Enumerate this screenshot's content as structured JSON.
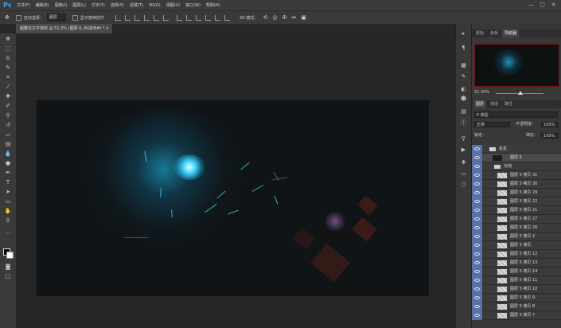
{
  "menubar": {
    "logo": "Ps",
    "items": [
      "文件(F)",
      "编辑(E)",
      "图像(I)",
      "图层(L)",
      "文字(Y)",
      "选择(S)",
      "滤镜(T)",
      "3D(D)",
      "视图(V)",
      "窗口(W)",
      "帮助(H)"
    ],
    "window_controls": [
      "—",
      "▢",
      "✕"
    ]
  },
  "options": {
    "auto_select_label": "自动选择：",
    "auto_select_value": "图层",
    "transform_label": "显示变换控件",
    "mode_3d_label": "3D 模式："
  },
  "document": {
    "tab_title": "超酷花文字特效 @ 51.3% (图层 6, RGB/8#) *",
    "close": "×"
  },
  "navigator": {
    "tabs": [
      "颜色",
      "色板",
      "导航器"
    ],
    "zoom": "51.34%"
  },
  "layers_panel": {
    "tabs": [
      "图层",
      "通道",
      "路径"
    ],
    "filter": "P 类型",
    "blend_mode": "正常",
    "opacity_label": "不透明度：",
    "opacity_value": "100%",
    "lock_label": "锁定：",
    "fill_label": "填充：",
    "fill_value": "100%",
    "rows": [
      {
        "name": "星星",
        "kind": "group"
      },
      {
        "name": "图层 6",
        "kind": "dark"
      },
      {
        "name": "光线",
        "kind": "sub"
      },
      {
        "name": "图层 5 拷贝 31",
        "kind": "layer"
      },
      {
        "name": "图层 5 拷贝 30",
        "kind": "layer"
      },
      {
        "name": "图层 5 拷贝 29",
        "kind": "layer"
      },
      {
        "name": "图层 5 拷贝 22",
        "kind": "layer"
      },
      {
        "name": "图层 5 拷贝 21",
        "kind": "layer"
      },
      {
        "name": "图层 5 拷贝 27",
        "kind": "layer"
      },
      {
        "name": "图层 5 拷贝 26",
        "kind": "layer"
      },
      {
        "name": "图层 5 拷贝 2",
        "kind": "layer"
      },
      {
        "name": "图层 5 拷贝",
        "kind": "layer"
      },
      {
        "name": "图层 5 拷贝 12",
        "kind": "layer"
      },
      {
        "name": "图层 5 拷贝 13",
        "kind": "layer"
      },
      {
        "name": "图层 5 拷贝 14",
        "kind": "layer"
      },
      {
        "name": "图层 5 拷贝 11",
        "kind": "layer"
      },
      {
        "name": "图层 5 拷贝 10",
        "kind": "layer"
      },
      {
        "name": "图层 5 拷贝 9",
        "kind": "layer"
      },
      {
        "name": "图层 5 拷贝 8",
        "kind": "layer"
      },
      {
        "name": "图层 5 拷贝 7",
        "kind": "layer"
      }
    ]
  },
  "colors": {
    "accent_blue": "#5772a6",
    "glow_cyan": "#1fc8ff",
    "canvas_bg": "#101416",
    "nav_border": "#7a1010"
  }
}
